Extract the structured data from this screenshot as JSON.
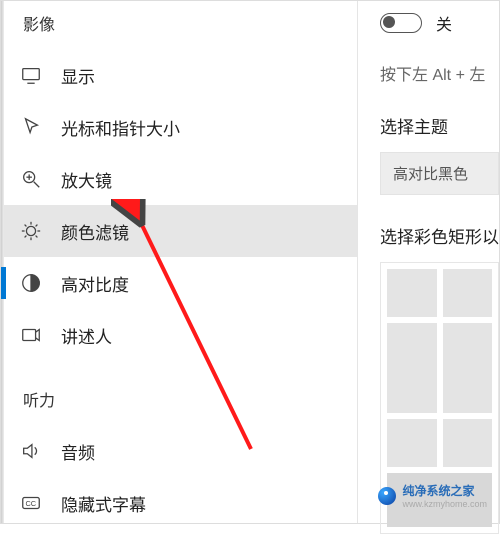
{
  "sidebar": {
    "sections": [
      {
        "title": "影像",
        "items": [
          {
            "label": "显示",
            "icon": "display-icon"
          },
          {
            "label": "光标和指针大小",
            "icon": "cursor-icon"
          },
          {
            "label": "放大镜",
            "icon": "magnifier-icon"
          },
          {
            "label": "颜色滤镜",
            "icon": "color-filter-icon",
            "selected": true
          },
          {
            "label": "高对比度",
            "icon": "contrast-icon",
            "bar": true
          },
          {
            "label": "讲述人",
            "icon": "narrator-icon"
          }
        ]
      },
      {
        "title": "听力",
        "items": [
          {
            "label": "音频",
            "icon": "audio-icon"
          },
          {
            "label": "隐藏式字幕",
            "icon": "captions-icon"
          }
        ]
      }
    ]
  },
  "content": {
    "toggle_state": "关",
    "hint": "按下左 Alt + 左",
    "theme_title": "选择主题",
    "theme_value": "高对比黑色",
    "shape_title": "选择彩色矩形以"
  },
  "watermark": {
    "brand": "纯净系统之家",
    "url": "www.kzmyhome.com"
  }
}
